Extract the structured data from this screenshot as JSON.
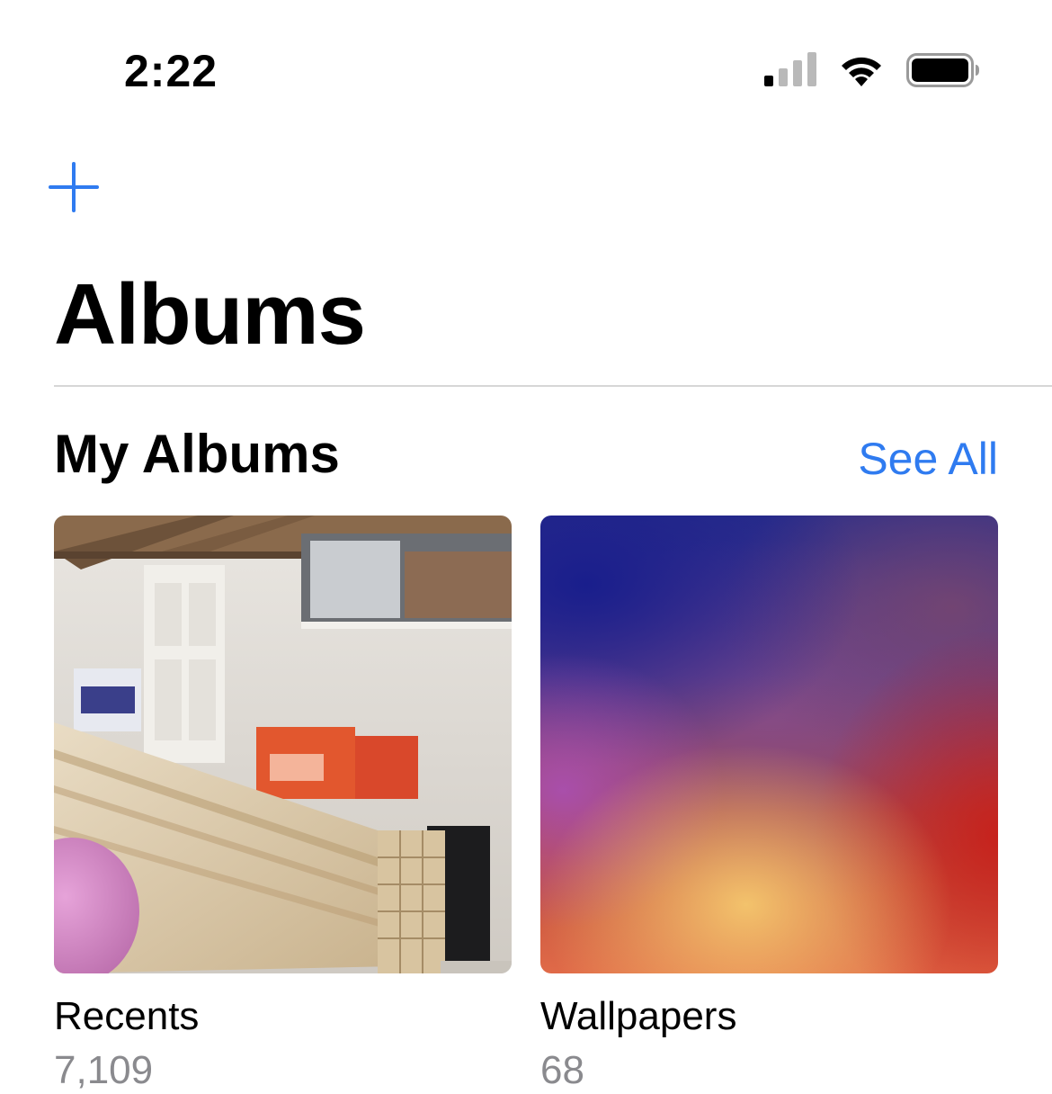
{
  "status_bar": {
    "time": "2:22",
    "icons": [
      "cellular-signal-icon",
      "wifi-icon",
      "battery-icon"
    ]
  },
  "nav": {
    "add_icon": "plus-icon"
  },
  "page": {
    "title": "Albums"
  },
  "section": {
    "title": "My Albums",
    "see_all_label": "See All"
  },
  "albums": [
    {
      "name": "Recents",
      "count": "7,109"
    },
    {
      "name": "Wallpapers",
      "count": "68"
    }
  ],
  "colors": {
    "accent": "#2f7bf0",
    "secondary_text": "#8a8a8e",
    "divider": "#d6d6d6"
  }
}
